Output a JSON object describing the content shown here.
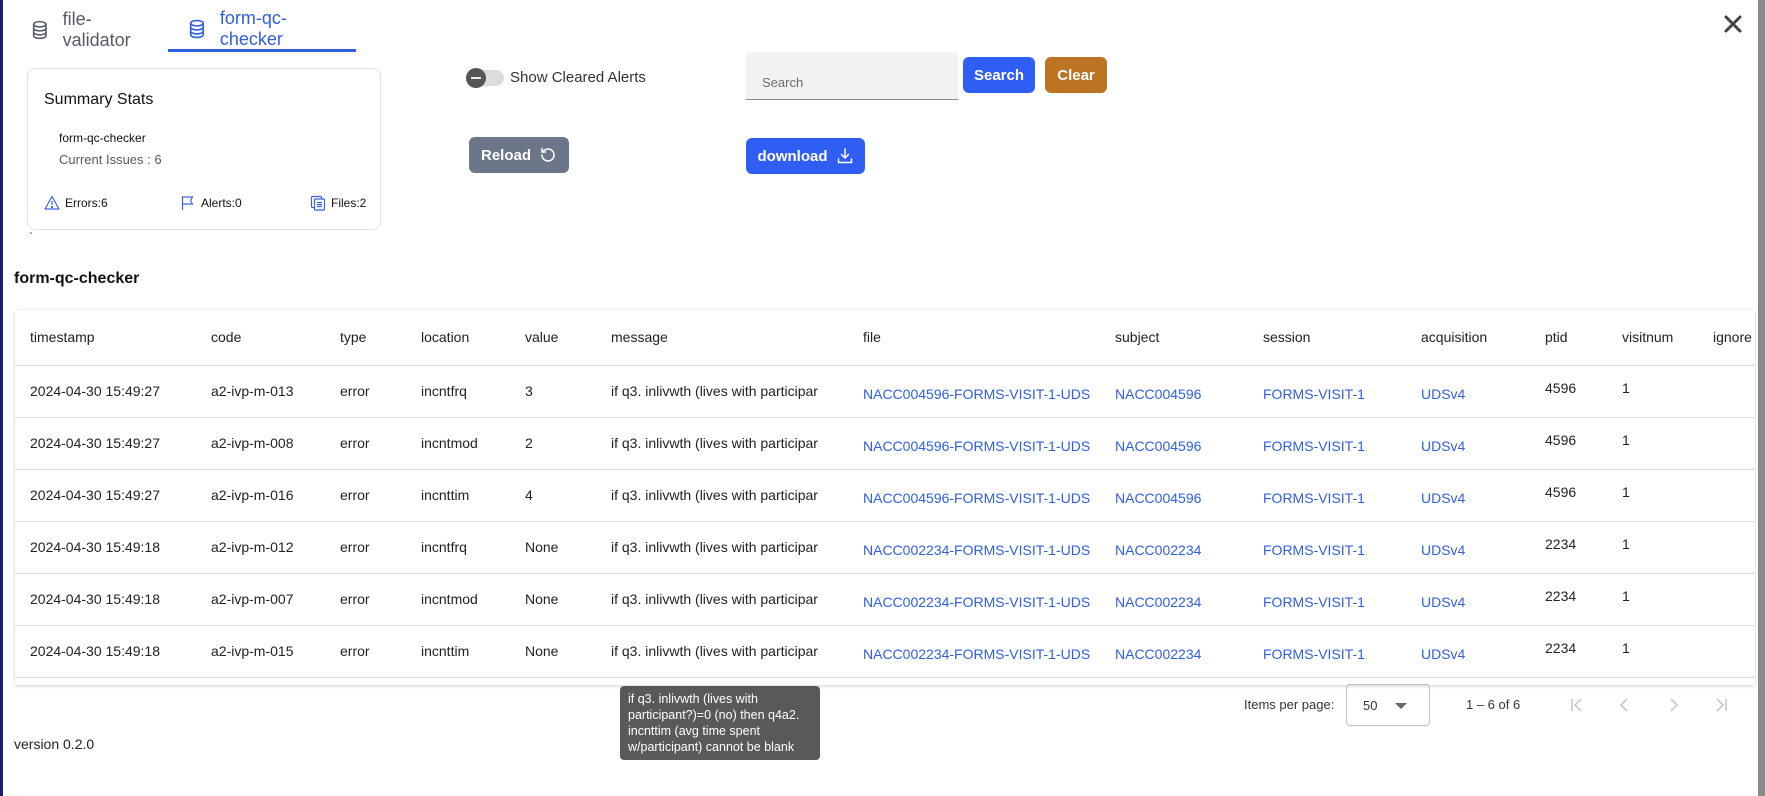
{
  "tabs": [
    {
      "label": "file-validator",
      "icon": "database-icon",
      "active": false
    },
    {
      "label": "form-qc-checker",
      "icon": "database-icon",
      "active": true
    }
  ],
  "close_icon": "close-icon",
  "summary": {
    "title": "Summary Stats",
    "gear_name": "form-qc-checker",
    "current_issues": "Current Issues : 6",
    "errors": "Errors:6",
    "alerts": "Alerts:0",
    "files": "Files:2",
    "stray_mark": "`"
  },
  "controls": {
    "toggle_label": "Show Cleared Alerts",
    "toggle_on": false,
    "search_placeholder": "Search",
    "search_value": "",
    "search_button": "Search",
    "clear_button": "Clear",
    "reload_button": "Reload",
    "download_button": "download"
  },
  "colors": {
    "accent": "#2f5fe0",
    "primary_button": "#2f5ef5",
    "clear_button": "#bc7423",
    "reload_button": "#6b7689"
  },
  "section_title": "form-qc-checker",
  "table": {
    "columns": [
      "timestamp",
      "code",
      "type",
      "location",
      "value",
      "message",
      "file",
      "subject",
      "session",
      "acquisition",
      "ptid",
      "visitnum",
      "ignore"
    ],
    "rows": [
      {
        "timestamp": "2024-04-30 15:49:27",
        "code": "a2-ivp-m-013",
        "type": "error",
        "location": "incntfrq",
        "value": "3",
        "message": "if q3. inlivwth (lives with participar",
        "file": "NACC004596-FORMS-VISIT-1-UDS",
        "subject": "NACC004596",
        "session": "FORMS-VISIT-1",
        "acquisition": "UDSv4",
        "ptid": "4596",
        "visitnum": "1",
        "ignore": ""
      },
      {
        "timestamp": "2024-04-30 15:49:27",
        "code": "a2-ivp-m-008",
        "type": "error",
        "location": "incntmod",
        "value": "2",
        "message": "if q3. inlivwth (lives with participar",
        "file": "NACC004596-FORMS-VISIT-1-UDS",
        "subject": "NACC004596",
        "session": "FORMS-VISIT-1",
        "acquisition": "UDSv4",
        "ptid": "4596",
        "visitnum": "1",
        "ignore": ""
      },
      {
        "timestamp": "2024-04-30 15:49:27",
        "code": "a2-ivp-m-016",
        "type": "error",
        "location": "incnttim",
        "value": "4",
        "message": "if q3. inlivwth (lives with participar",
        "file": "NACC004596-FORMS-VISIT-1-UDS",
        "subject": "NACC004596",
        "session": "FORMS-VISIT-1",
        "acquisition": "UDSv4",
        "ptid": "4596",
        "visitnum": "1",
        "ignore": ""
      },
      {
        "timestamp": "2024-04-30 15:49:18",
        "code": "a2-ivp-m-012",
        "type": "error",
        "location": "incntfrq",
        "value": "None",
        "message": "if q3. inlivwth (lives with participar",
        "file": "NACC002234-FORMS-VISIT-1-UDS",
        "subject": "NACC002234",
        "session": "FORMS-VISIT-1",
        "acquisition": "UDSv4",
        "ptid": "2234",
        "visitnum": "1",
        "ignore": ""
      },
      {
        "timestamp": "2024-04-30 15:49:18",
        "code": "a2-ivp-m-007",
        "type": "error",
        "location": "incntmod",
        "value": "None",
        "message": "if q3. inlivwth (lives with participar",
        "file": "NACC002234-FORMS-VISIT-1-UDS",
        "subject": "NACC002234",
        "session": "FORMS-VISIT-1",
        "acquisition": "UDSv4",
        "ptid": "2234",
        "visitnum": "1",
        "ignore": ""
      },
      {
        "timestamp": "2024-04-30 15:49:18",
        "code": "a2-ivp-m-015",
        "type": "error",
        "location": "incnttim",
        "value": "None",
        "message": "if q3. inlivwth (lives with participar",
        "file": "NACC002234-FORMS-VISIT-1-UDS",
        "subject": "NACC002234",
        "session": "FORMS-VISIT-1",
        "acquisition": "UDSv4",
        "ptid": "2234",
        "visitnum": "1",
        "ignore": ""
      }
    ]
  },
  "tooltip": "if q3. inlivwth (lives with participant?)=0 (no) then q4a2. incnttim (avg time spent w/participant) cannot be blank",
  "pagination": {
    "items_per_page_label": "Items per page:",
    "items_per_page": "50",
    "range": "1 – 6 of 6"
  },
  "version": "version 0.2.0"
}
